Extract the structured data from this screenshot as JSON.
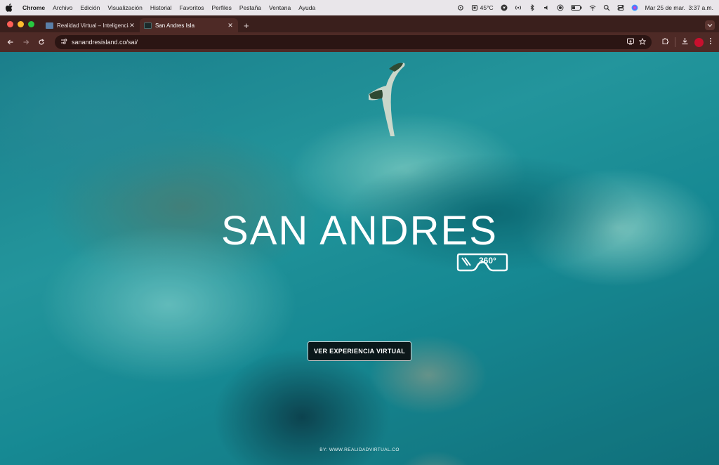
{
  "menubar": {
    "app_name": "Chrome",
    "items": [
      "Archivo",
      "Edición",
      "Visualización",
      "Historial",
      "Favoritos",
      "Perfiles",
      "Pestaña",
      "Ventana",
      "Ayuda"
    ],
    "temperature": "45°C",
    "datetime": "Mar 25 de mar.  3:37 a.m."
  },
  "tabs": [
    {
      "title": "Realidad Virtual – Inteligencia",
      "favicon_color": "#5a7fa8",
      "active": false
    },
    {
      "title": "San Andres Isla",
      "favicon_color": "#1b2a2a",
      "active": true
    }
  ],
  "toolbar": {
    "url": "sanandresisland.co/sai/"
  },
  "page": {
    "title": "SAN ANDRES",
    "vr_badge": "360°",
    "cta_label": "VER EXPERIENCIA VIRTUAL",
    "credit": "BY: WWW.REALIDADVIRTUAL.CO"
  },
  "colors": {
    "tabstrip": "#3a1f1c",
    "toolbar": "#4e2a26",
    "accent_red": "#c8102e"
  }
}
